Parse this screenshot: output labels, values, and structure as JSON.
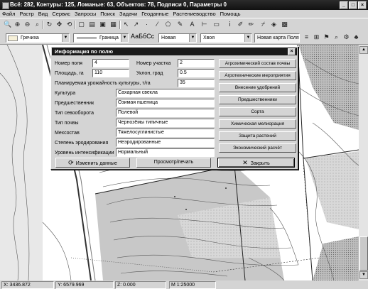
{
  "window": {
    "title": "Всё: 282, Контуры: 125, Ломаные: 63, Объектов: 78, Подписи 0, Параметры 0",
    "min": "_",
    "max": "□",
    "close": "×"
  },
  "menu": [
    "Файл",
    "Растр",
    "Вид",
    "Сервис",
    "Запросы",
    "Поиск",
    "Задачи",
    "Геоданные",
    "Растениеводство",
    "Помощь"
  ],
  "toolbar2": {
    "fill_combo": "Гречиха",
    "line_combo": "Граница",
    "font_sample": "АаБбСс",
    "font_combo": "Новая",
    "symbol_combo": "Хвоя",
    "map_label": "Новая карта Поля"
  },
  "status": {
    "x": "X: 3436.872",
    "y": "Y: 6579.969",
    "z": "Z: 0.000",
    "scale": "М 1:25000"
  },
  "dialog": {
    "title": "Информация по полю",
    "close": "×",
    "field_no_label": "Номер поля",
    "field_no": "4",
    "plot_no_label": "Номер участка",
    "plot_no": "2",
    "area_label": "Площадь, га",
    "area": "110",
    "slope_label": "Уклон, град",
    "slope": "0.5",
    "yield_label": "Планируемая урожайность культуры, т/га",
    "yield": "35",
    "culture_label": "Культура",
    "culture": "Сахарная свекла",
    "predecessor_label": "Предшественник",
    "predecessor": "Озимая пшеница",
    "rotation_label": "Тип севооборота",
    "rotation": "Полевой",
    "soil_type_label": "Тип почвы",
    "soil_type": "Чернозёмы типичные",
    "mech_label": "Мехсостав",
    "mech": "Тяжелосуглинистые",
    "erosion_label": "Степень эродирования",
    "erosion": "Неэродированные",
    "intensity_label": "Уровень интенсификации",
    "intensity": "Нормальный",
    "side_buttons": [
      "Агрохимический состав почвы",
      "Агротехнические мероприятия",
      "Внесение удобрений",
      "Предшественники",
      "Сорта",
      "Химическая мелиорация",
      "Защита растений",
      "Экономический расчёт"
    ],
    "btn_edit": "Изменить данные",
    "btn_print": "Просмотр/печать",
    "btn_close": "Закрыть"
  }
}
